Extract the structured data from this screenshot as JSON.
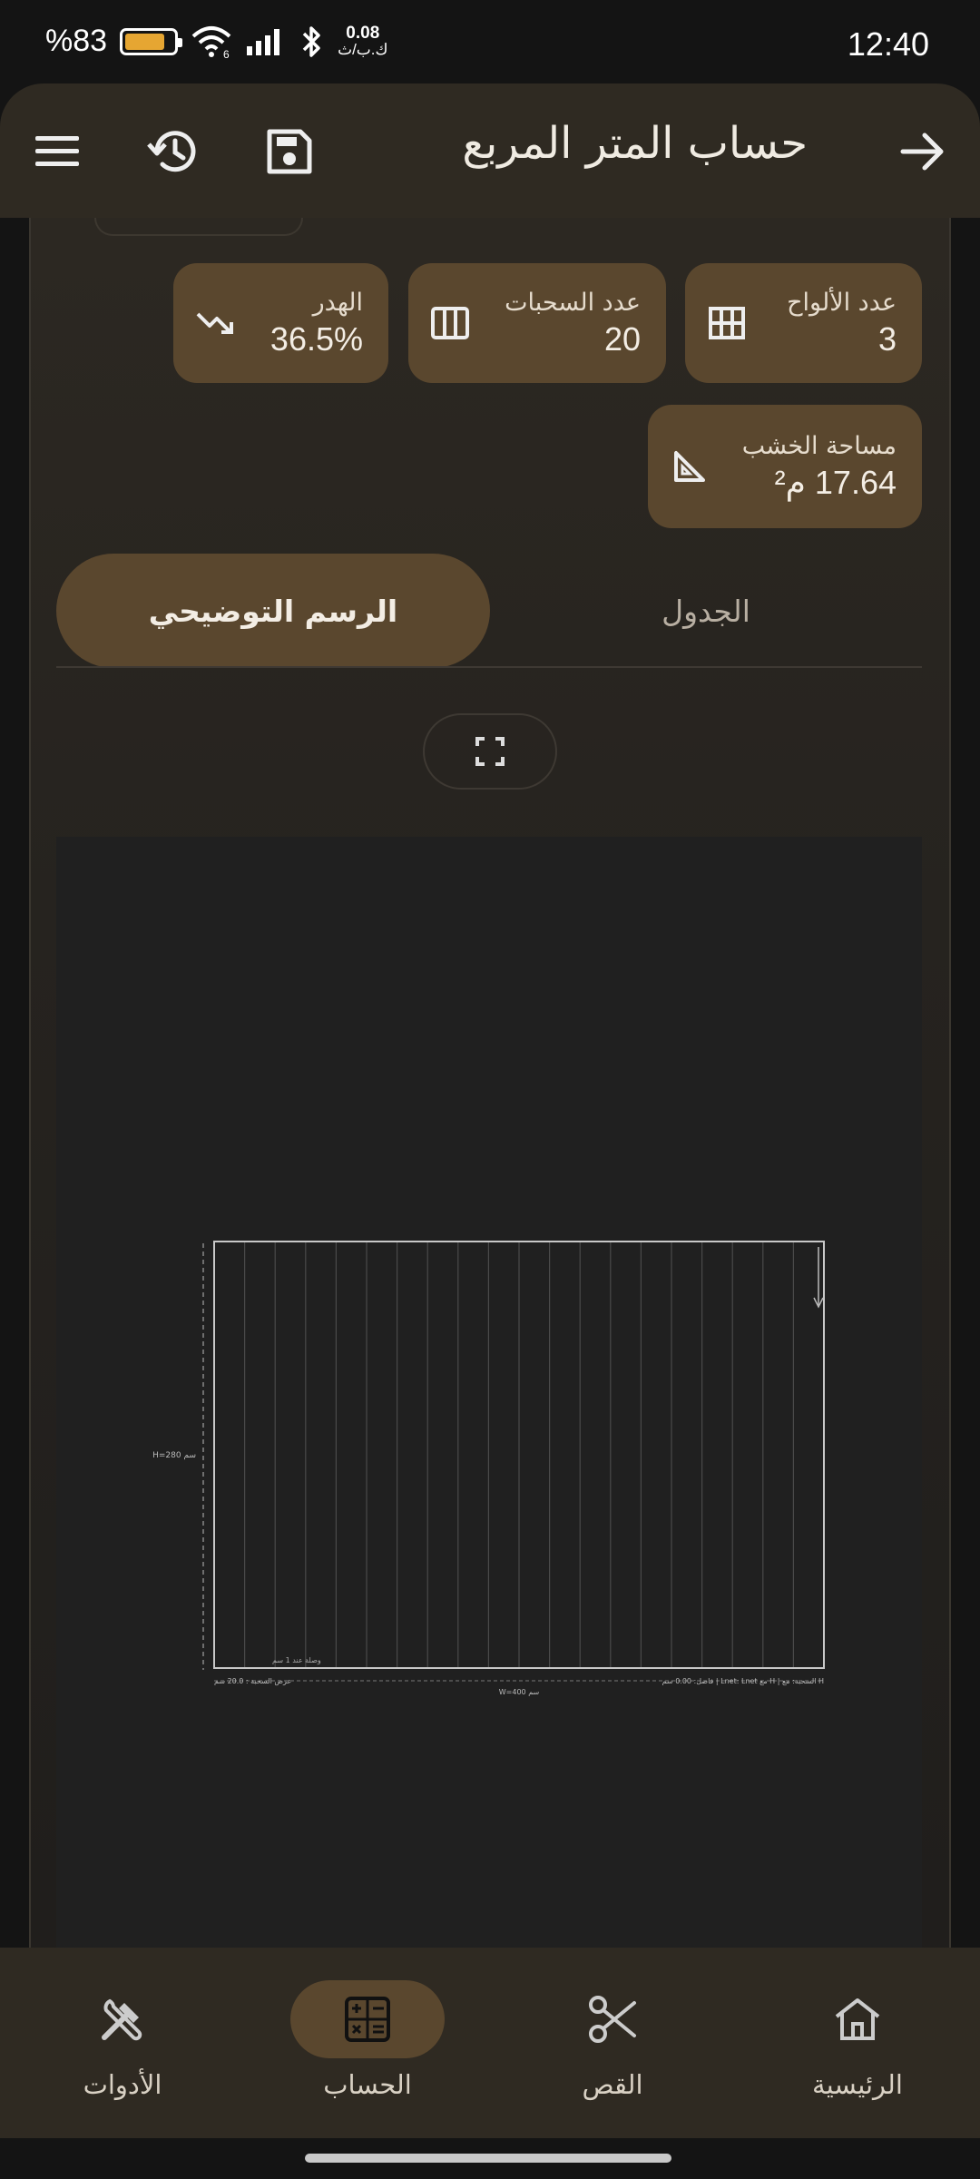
{
  "status_bar": {
    "time": "12:40",
    "battery_percent": "%83",
    "battery_level": 0.83,
    "net_speed_value": "0.08",
    "net_speed_unit": "ك.ب/ث",
    "wifi_badge": "6",
    "icons": [
      "battery-icon",
      "wifi-icon",
      "signal-icon",
      "bluetooth-icon"
    ]
  },
  "app_bar": {
    "title": "حساب المتر المربع",
    "icons": [
      "back-arrow-icon",
      "save-icon",
      "history-icon",
      "menu-icon"
    ]
  },
  "stats": {
    "boards": {
      "label": "عدد الألواح",
      "value": "3",
      "icon": "grid-icon"
    },
    "slats": {
      "label": "عدد السحبات",
      "value": "20",
      "icon": "columns-icon"
    },
    "waste": {
      "label": "الهدر",
      "value": "36.5%",
      "icon": "trending-down-icon"
    },
    "wood_area": {
      "label": "مساحة الخشب",
      "value": "17.64 م²",
      "icon": "set-square-icon"
    }
  },
  "tabs": {
    "diagram": "الرسم التوضيحي",
    "table": "الجدول",
    "active": "diagram"
  },
  "diagram": {
    "height_label": "H=280 سم",
    "width_label": "W=400 سم",
    "joint_label": "وصلة عند 1 سم",
    "slat_width_label": "عرض السحبة : 20.0 سم",
    "info_label": "فاصل: 0.00 سم | Lnet: Lnet مع H | السحبة: مع H",
    "slat_count": 20,
    "accent_color": "#c8c8c8"
  },
  "bottom_nav": {
    "home": "الرئيسية",
    "cut": "القص",
    "calc": "الحساب",
    "tools": "الأدوات",
    "active": "calc"
  },
  "colors": {
    "accent": "#5a472e",
    "surface": "#2f2a22",
    "background": "#141414",
    "battery": "#e6a632"
  }
}
